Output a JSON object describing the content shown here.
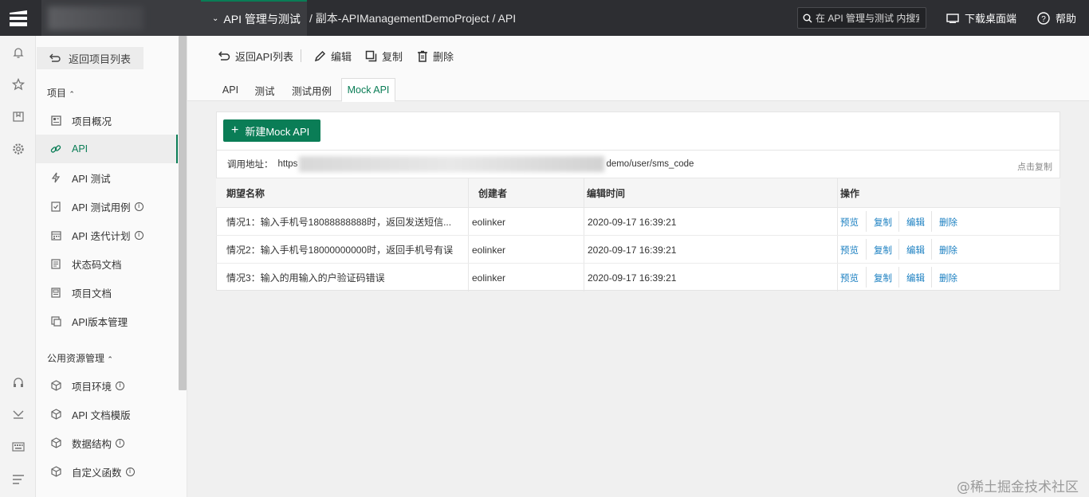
{
  "topbar": {
    "module_label": "API 管理与测试",
    "breadcrumb": "/ 副本-APIManagementDemoProject / API",
    "search_placeholder": "在 API 管理与测试 内搜索",
    "download_label": "下载桌面端",
    "help_label": "帮助"
  },
  "rail": {
    "icons": [
      "bell-icon",
      "star-icon",
      "book-icon",
      "gear-icon",
      "headset-icon",
      "download-icon",
      "keyboard-icon",
      "menu-icon"
    ]
  },
  "sidebar": {
    "back_label": "返回项目列表",
    "project_section": "项目",
    "project_items": [
      {
        "label": "项目概况",
        "icon": "dashboard-icon",
        "info": false
      },
      {
        "label": "API",
        "icon": "link-icon",
        "info": false,
        "active": true
      },
      {
        "label": "API 测试",
        "icon": "lightning-icon",
        "info": false
      },
      {
        "label": "API 测试用例",
        "icon": "clipboard-check-icon",
        "info": true
      },
      {
        "label": "API 迭代计划",
        "icon": "calendar-icon",
        "info": true
      },
      {
        "label": "状态码文档",
        "icon": "file-text-icon",
        "info": false
      },
      {
        "label": "项目文档",
        "icon": "document-icon",
        "info": false
      },
      {
        "label": "API版本管理",
        "icon": "versions-icon",
        "info": false
      }
    ],
    "public_section": "公用资源管理",
    "public_items": [
      {
        "label": "项目环境",
        "icon": "cube-icon",
        "info": true
      },
      {
        "label": "API 文档模版",
        "icon": "cube-icon",
        "info": false
      },
      {
        "label": "数据结构",
        "icon": "cube-icon",
        "info": true
      },
      {
        "label": "自定义函数",
        "icon": "cube-icon",
        "info": true
      }
    ]
  },
  "toolbar": {
    "back_label": "返回API列表",
    "edit_label": "编辑",
    "copy_label": "复制",
    "delete_label": "删除"
  },
  "tabs": [
    "API",
    "测试",
    "测试用例",
    "Mock API"
  ],
  "active_tab": "Mock API",
  "mock": {
    "new_button": "新建Mock API",
    "url_label": "调用地址：",
    "url_prefix": "https",
    "url_suffix": "demo/user/sms_code",
    "copy_link": "点击复制",
    "columns": [
      "期望名称",
      "创建者",
      "编辑时间",
      "操作"
    ],
    "actions": [
      "预览",
      "复制",
      "编辑",
      "删除"
    ],
    "rows": [
      {
        "name": "情况1：输入手机号18088888888时，返回发送短信...",
        "creator": "eolinker",
        "time": "2020-09-17 16:39:21"
      },
      {
        "name": "情况2：输入手机号18000000000时，返回手机号有误",
        "creator": "eolinker",
        "time": "2020-09-17 16:39:21"
      },
      {
        "name": "情况3：输入的用输入的户验证码错误",
        "creator": "eolinker",
        "time": "2020-09-17 16:39:21"
      }
    ]
  },
  "watermark": "@稀土掘金技术社区",
  "colors": {
    "accent": "#0a7d56",
    "topbar": "#2d2e32",
    "link": "#1a7fc1"
  }
}
